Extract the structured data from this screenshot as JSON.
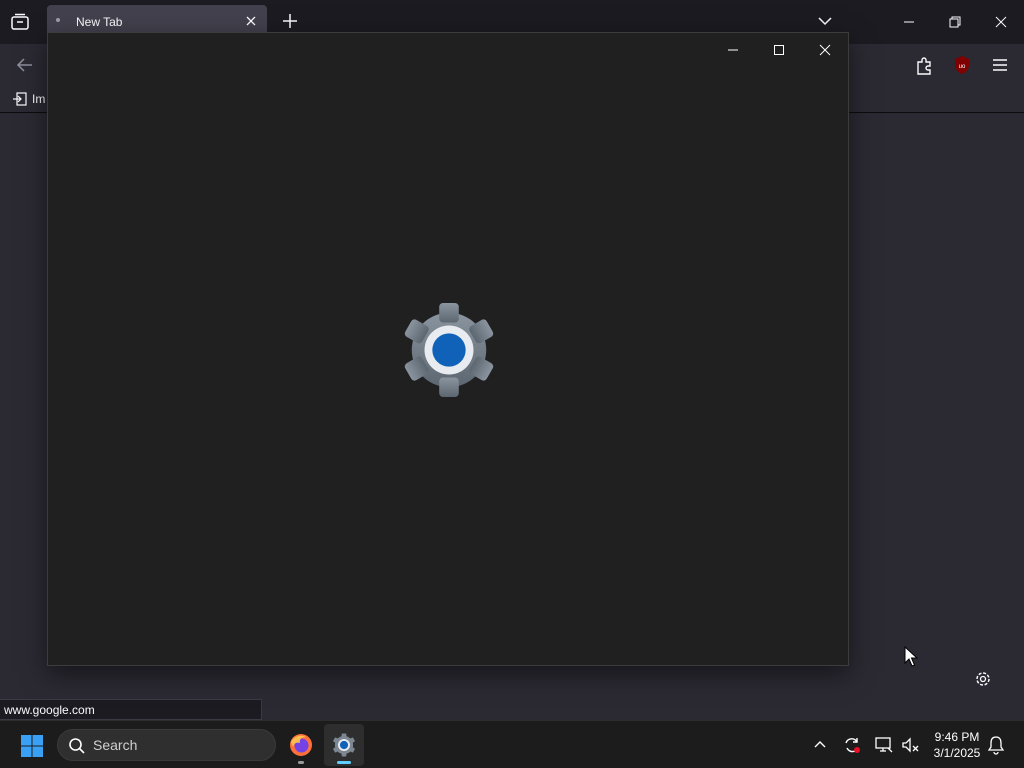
{
  "browser": {
    "tab": {
      "title": "New Tab"
    },
    "bookmarks": {
      "import_label": "Im"
    },
    "status_url": "www.google.com"
  },
  "settings_window": {
    "splash_icon": "settings-gear-icon"
  },
  "taskbar": {
    "search_label": "Search",
    "apps": [
      "firefox-icon",
      "settings-icon"
    ],
    "clock": {
      "time": "9:46 PM",
      "date": "3/1/2025"
    }
  },
  "colors": {
    "accent": "#60cdff",
    "gear_blue": "#0f62b8",
    "gear_gray": "#6f7a86"
  }
}
